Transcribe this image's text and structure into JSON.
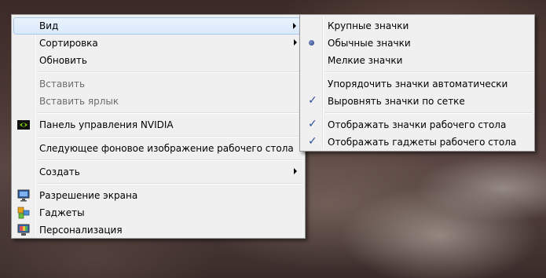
{
  "main_menu": {
    "items": [
      {
        "label": "Вид",
        "has_submenu": true,
        "highlighted": true
      },
      {
        "label": "Сортировка",
        "has_submenu": true
      },
      {
        "label": "Обновить"
      },
      {
        "label": "Вставить",
        "disabled": true
      },
      {
        "label": "Вставить ярлык",
        "disabled": true
      },
      {
        "label": "Панель управления NVIDIA",
        "icon": "nvidia-icon"
      },
      {
        "label": "Следующее фоновое изображение рабочего стола"
      },
      {
        "label": "Создать",
        "has_submenu": true
      },
      {
        "label": "Разрешение экрана",
        "icon": "monitor-icon"
      },
      {
        "label": "Гаджеты",
        "icon": "gadgets-icon"
      },
      {
        "label": "Персонализация",
        "icon": "personalization-icon"
      }
    ]
  },
  "view_submenu": {
    "items": [
      {
        "label": "Крупные значки"
      },
      {
        "label": "Обычные значки",
        "selected": true
      },
      {
        "label": "Мелкие значки"
      },
      {
        "label": "Упорядочить значки автоматически"
      },
      {
        "label": "Выровнять значки по сетке",
        "checked": true
      },
      {
        "label": "Отображать значки рабочего стола",
        "checked": true
      },
      {
        "label": "Отображать гаджеты  рабочего стола",
        "checked": true
      }
    ]
  },
  "colors": {
    "menu_background": "#f0f0f0",
    "highlight": "#d9e9fb",
    "check_mark": "#2d4f9a"
  }
}
